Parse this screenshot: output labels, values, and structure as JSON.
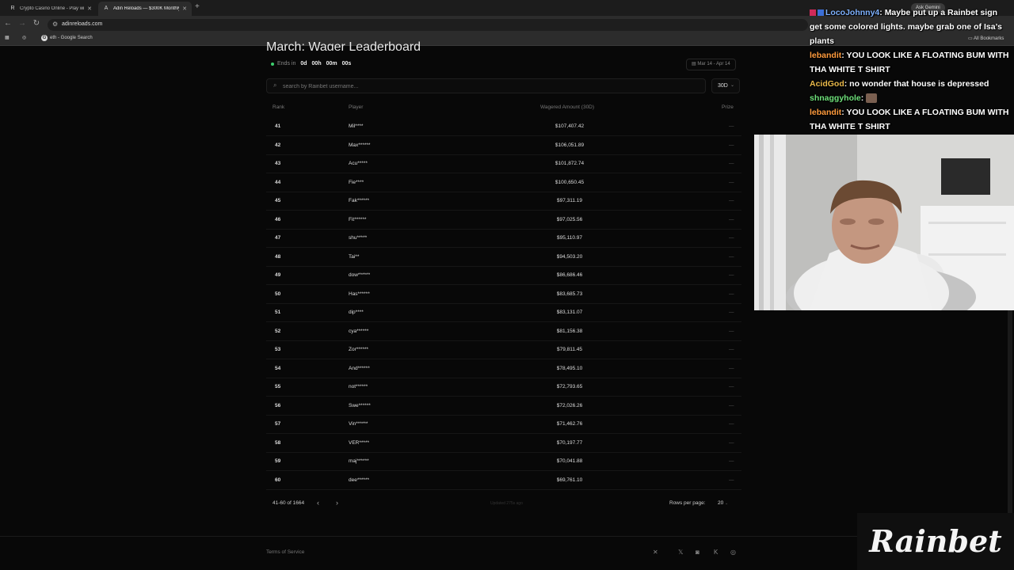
{
  "browser": {
    "tabs": [
      {
        "title": "Crypto Casino Online - Play with",
        "favicon": "R",
        "active": false
      },
      {
        "title": "Adin Reloads — $300K Monthly",
        "favicon": "A",
        "active": true
      }
    ],
    "url": "adinreloads.com",
    "bookmark": "eth - Google Search",
    "ask_gemini": "Ask Gemini",
    "all_bookmarks": "All Bookmarks"
  },
  "leaderboard": {
    "title": "March: Wager Leaderboard",
    "ends_label": "Ends in",
    "countdown": {
      "d": "0d",
      "h": "00h",
      "m": "00m",
      "s": "00s"
    },
    "date_range": "Mar 14 - Apr 14",
    "search_placeholder": "search by Rainbet username...",
    "period": "30D",
    "columns": {
      "rank": "Rank",
      "player": "Player",
      "wagered": "Wagered Amount (30D)",
      "prize": "Prize"
    },
    "rows": [
      {
        "rank": "41",
        "player": "Mil****",
        "amount": "$107,407.42",
        "prize": "—"
      },
      {
        "rank": "42",
        "player": "Max******",
        "amount": "$106,051.89",
        "prize": "—"
      },
      {
        "rank": "43",
        "player": "Acu*****",
        "amount": "$101,872.74",
        "prize": "—"
      },
      {
        "rank": "44",
        "player": "Fie****",
        "amount": "$100,650.45",
        "prize": "—"
      },
      {
        "rank": "45",
        "player": "Fak******",
        "amount": "$97,311.19",
        "prize": "—"
      },
      {
        "rank": "46",
        "player": "Fit******",
        "amount": "$97,025.56",
        "prize": "—"
      },
      {
        "rank": "47",
        "player": "shu*****",
        "amount": "$95,110.97",
        "prize": "—"
      },
      {
        "rank": "48",
        "player": "Tai**",
        "amount": "$94,503.20",
        "prize": "—"
      },
      {
        "rank": "49",
        "player": "dow******",
        "amount": "$86,686.46",
        "prize": "—"
      },
      {
        "rank": "50",
        "player": "Has******",
        "amount": "$83,685.73",
        "prize": "—"
      },
      {
        "rank": "51",
        "player": "dip****",
        "amount": "$83,131.07",
        "prize": "—"
      },
      {
        "rank": "52",
        "player": "cya******",
        "amount": "$81,156.38",
        "prize": "—"
      },
      {
        "rank": "53",
        "player": "Zor******",
        "amount": "$79,811.45",
        "prize": "—"
      },
      {
        "rank": "54",
        "player": "And******",
        "amount": "$78,495.10",
        "prize": "—"
      },
      {
        "rank": "55",
        "player": "not******",
        "amount": "$72,793.65",
        "prize": "—"
      },
      {
        "rank": "56",
        "player": "Swe******",
        "amount": "$72,026.26",
        "prize": "—"
      },
      {
        "rank": "57",
        "player": "Vin******",
        "amount": "$71,462.76",
        "prize": "—"
      },
      {
        "rank": "58",
        "player": "VER*****",
        "amount": "$70,197.77",
        "prize": "—"
      },
      {
        "rank": "59",
        "player": "maj******",
        "amount": "$70,041.88",
        "prize": "—"
      },
      {
        "rank": "60",
        "player": "dee******",
        "amount": "$69,761.10",
        "prize": "—"
      }
    ],
    "pagination": {
      "range": "41-60 of 1664",
      "updated": "Updated 275s ago",
      "rows_per_page_label": "Rows per page:",
      "rows_per_page": "20"
    },
    "footer": {
      "terms": "Terms of Service"
    }
  },
  "chat": [
    {
      "user": "LocoJohnny4",
      "color": "#7fb2ff",
      "text": "Maybe put up a Rainbet sign get some colored lights. maybe grab one of Isa’s plants"
    },
    {
      "user": "lebandit",
      "color": "#ff9b3d",
      "text": "YOU LOOK LIKE A FLOATING BUM WITH THA WHITE T SHIRT"
    },
    {
      "user": "AcidGod",
      "color": "#e8b84a",
      "text": "no wonder that house is depressed"
    },
    {
      "user": "shnaggyhole",
      "color": "#6ee07a",
      "text": ""
    },
    {
      "user": "lebandit",
      "color": "#ff9b3d",
      "text": "YOU LOOK LIKE A FLOATING BUM WITH THA WHITE T SHIRT"
    }
  ],
  "brand_logo": "Rainbet"
}
